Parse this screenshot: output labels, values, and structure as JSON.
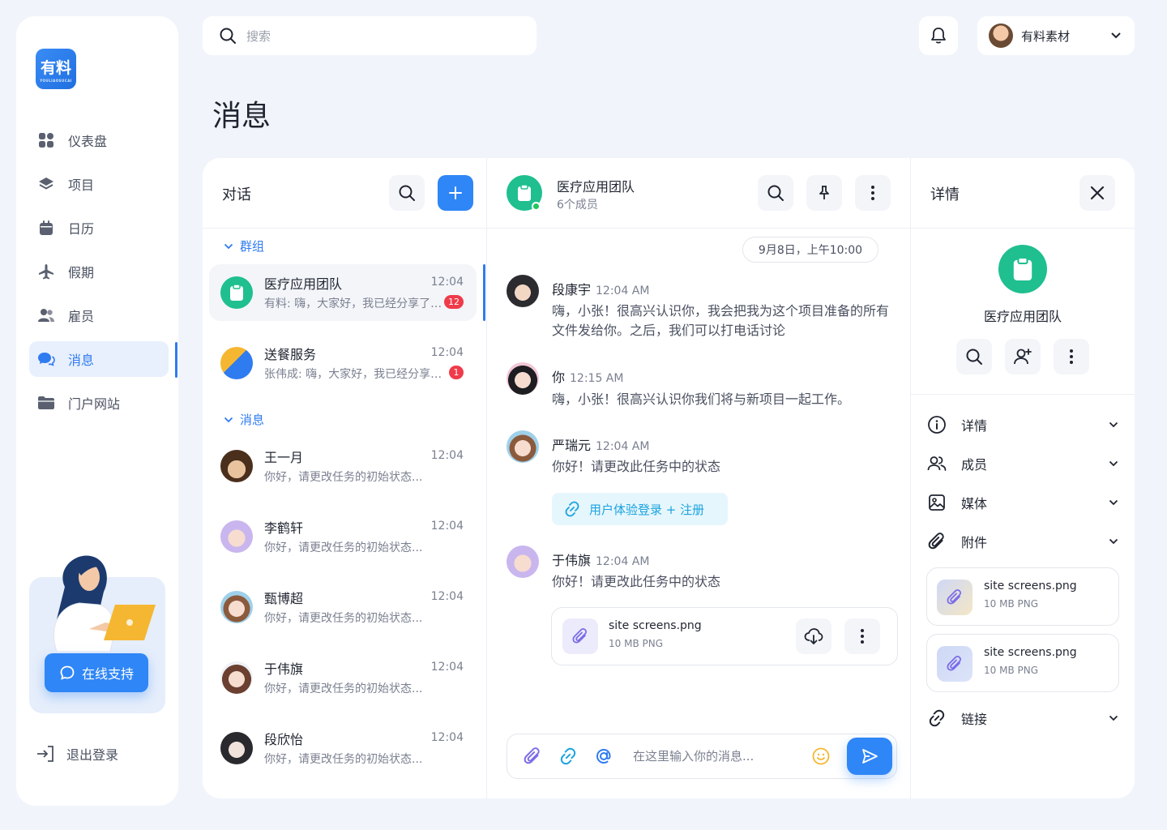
{
  "brand": {
    "logo_text": "有料",
    "logo_sub": "YOULIAOSUCAI"
  },
  "nav": [
    {
      "label": "仪表盘",
      "icon": "dashboard-icon"
    },
    {
      "label": "项目",
      "icon": "layers-icon"
    },
    {
      "label": "日历",
      "icon": "calendar-icon"
    },
    {
      "label": "假期",
      "icon": "airplane-icon"
    },
    {
      "label": "雇员",
      "icon": "employees-icon"
    },
    {
      "label": "消息",
      "icon": "messages-icon",
      "active": true
    },
    {
      "label": "门户网站",
      "icon": "folder-icon"
    }
  ],
  "support": {
    "button": "在线支持"
  },
  "logout": "退出登录",
  "search": {
    "placeholder": "搜索"
  },
  "user": {
    "name": "有料素材"
  },
  "page_title": "消息",
  "conversations": {
    "title": "对话",
    "groups_label": "群组",
    "messages_label": "消息",
    "groups": [
      {
        "name": "医疗应用团队",
        "time": "12:04",
        "preview": "有料: 嗨，大家好，我已经分享了一个文件",
        "badge": "12"
      },
      {
        "name": "送餐服务",
        "time": "12:04",
        "preview": "张伟成: 嗨，大家好，我已经分享了一个文件",
        "badge": "1"
      }
    ],
    "direct": [
      {
        "name": "王一月",
        "time": "12:04",
        "preview": "你好，请更改任务的初始状态..."
      },
      {
        "name": "李鹤轩",
        "time": "12:04",
        "preview": "你好，请更改任务的初始状态..."
      },
      {
        "name": "甄博超",
        "time": "12:04",
        "preview": "你好，请更改任务的初始状态..."
      },
      {
        "name": "于伟旗",
        "time": "12:04",
        "preview": "你好，请更改任务的初始状态..."
      },
      {
        "name": "段欣怡",
        "time": "12:04",
        "preview": "你好，请更改任务的初始状态..."
      }
    ]
  },
  "chat": {
    "title": "医疗应用团队",
    "subtitle": "6个成员",
    "date": "9月8日，上午10:00",
    "messages": [
      {
        "name": "段康宇",
        "time": "12:04 AM",
        "text1": "嗨，小张！很高兴认识你，我会把我为这个项目准备的所有",
        "text2": "文件发给你。之后，我们可以打电话讨论"
      },
      {
        "name": "你",
        "time": "12:15 AM",
        "text1": "嗨，小张！很高兴认识你我们将与新项目一起工作。"
      },
      {
        "name": "严瑞元",
        "time": "12:04 AM",
        "text1": "你好！请更改此任务中的状态",
        "link": "用户体验登录 + 注册"
      },
      {
        "name": "于伟旗",
        "time": "12:04 AM",
        "text1": "你好！请更改此任务中的状态",
        "file_name": "site screens.png",
        "file_meta": "10 MB PNG"
      }
    ],
    "composer_placeholder": "在这里输入你的消息..."
  },
  "details": {
    "title": "详情",
    "group_name": "医疗应用团队",
    "sections": [
      {
        "label": "详情",
        "icon": "info-icon"
      },
      {
        "label": "成员",
        "icon": "members-icon"
      },
      {
        "label": "媒体",
        "icon": "image-icon"
      },
      {
        "label": "附件",
        "icon": "paperclip-icon"
      }
    ],
    "files": [
      {
        "name": "site screens.png",
        "meta": "10 MB PNG"
      },
      {
        "name": "site screens.png",
        "meta": "10 MB PNG"
      }
    ],
    "link_label": "链接"
  },
  "colors": {
    "accent": "#2f86f6",
    "green": "#1fbf8f",
    "badge": "#ef3b4a",
    "link": "#1aa3e0"
  }
}
